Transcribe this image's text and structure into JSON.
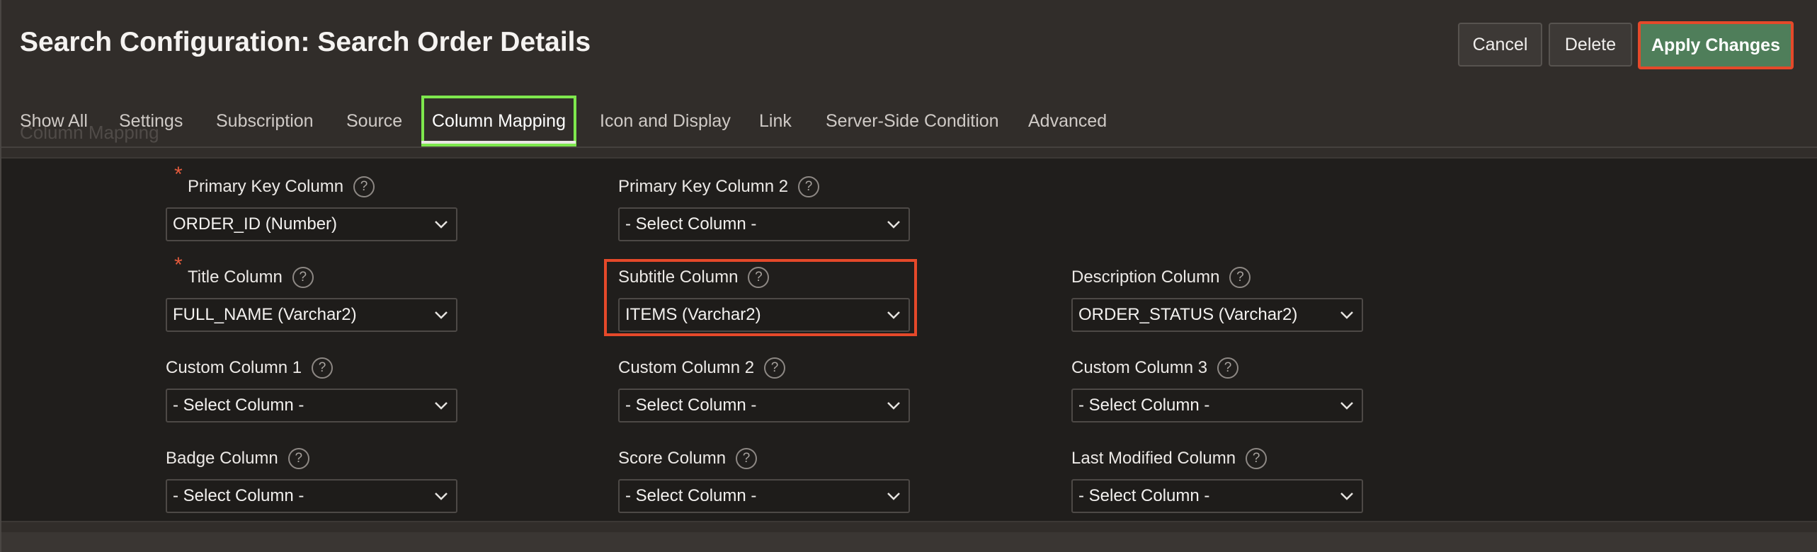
{
  "header": {
    "title": "Search Configuration: Search Order Details",
    "cancel_label": "Cancel",
    "delete_label": "Delete",
    "apply_label": "Apply Changes"
  },
  "tabs": [
    {
      "label": "Show All"
    },
    {
      "label": "Settings"
    },
    {
      "label": "Subscription"
    },
    {
      "label": "Source"
    },
    {
      "label": "Column Mapping",
      "active": true
    },
    {
      "label": "Icon and Display"
    },
    {
      "label": "Link"
    },
    {
      "label": "Server-Side Condition"
    },
    {
      "label": "Advanced"
    }
  ],
  "section": {
    "heading": "Column Mapping"
  },
  "fields": {
    "primary_key": {
      "label": "Primary Key Column",
      "value": "ORDER_ID (Number)",
      "required": true
    },
    "primary_key_2": {
      "label": "Primary Key Column 2",
      "value": "- Select Column -"
    },
    "title": {
      "label": "Title Column",
      "value": "FULL_NAME (Varchar2)",
      "required": true
    },
    "subtitle": {
      "label": "Subtitle Column",
      "value": "ITEMS (Varchar2)"
    },
    "description": {
      "label": "Description Column",
      "value": "ORDER_STATUS (Varchar2)"
    },
    "custom_1": {
      "label": "Custom Column 1",
      "value": "- Select Column -"
    },
    "custom_2": {
      "label": "Custom Column 2",
      "value": "- Select Column -"
    },
    "custom_3": {
      "label": "Custom Column 3",
      "value": "- Select Column -"
    },
    "badge": {
      "label": "Badge Column",
      "value": "- Select Column -"
    },
    "score": {
      "label": "Score Column",
      "value": "- Select Column -"
    },
    "last_modified": {
      "label": "Last Modified Column",
      "value": "- Select Column -"
    }
  },
  "icons": {
    "help": "?",
    "required": "*"
  },
  "colors": {
    "apply_button": "#4f7e5a",
    "annotation_red": "#e5492a",
    "annotation_green": "#7ee74d",
    "required_asterisk": "#e15a3c"
  }
}
